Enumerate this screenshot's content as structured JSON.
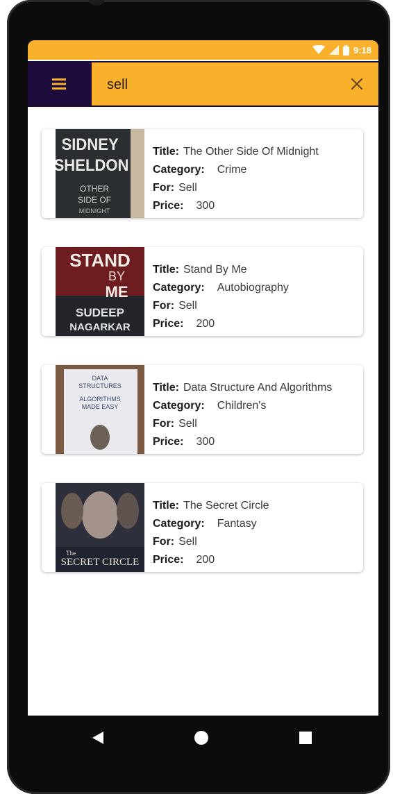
{
  "status": {
    "time": "9:18"
  },
  "search": {
    "value": "sell"
  },
  "books": [
    {
      "title": "The Other Side Of Midnight",
      "category": "Crime",
      "for": "Sell",
      "price": "300",
      "cover": {
        "lines": [
          "SIDNEY",
          "SHELDON",
          "OTHER",
          "SIDE OF",
          "MIDNIGHT"
        ]
      }
    },
    {
      "title": "Stand By Me",
      "category": "Autobiography",
      "for": "Sell",
      "price": "200",
      "cover": {
        "lines": [
          "STAND",
          "BY",
          "ME",
          "SUDEEP",
          "NAGARKAR"
        ]
      }
    },
    {
      "title": "Data Structure And Algorithms",
      "category": "Children's",
      "for": "Sell",
      "price": "300",
      "cover": {
        "lines": [
          "DATA",
          "STRUCTURES",
          "ALGORITHMS",
          "MADE EASY"
        ]
      }
    },
    {
      "title": "The Secret Circle",
      "category": "Fantasy",
      "for": "Sell",
      "price": "200",
      "cover": {
        "lines": [
          "The",
          "SECRET CIRCLE"
        ]
      }
    }
  ],
  "labels": {
    "title": "Title:",
    "category": "Category:",
    "for": "For:",
    "price": "Price:"
  },
  "colors": {
    "accent": "#F9B02B",
    "appbar": "#1d0b3b"
  },
  "icons": {
    "menu": "hamburger-icon",
    "clear": "close-icon",
    "back": "back-triangle-icon",
    "home": "home-circle-icon",
    "recents": "recents-square-icon"
  }
}
